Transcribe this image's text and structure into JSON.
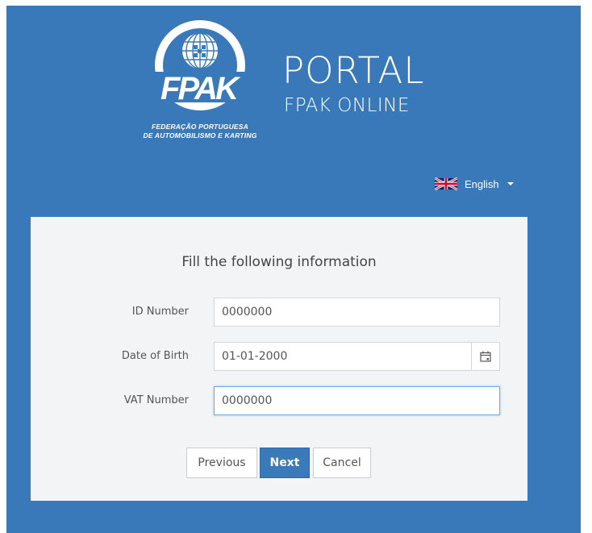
{
  "logo": {
    "initials": "FPAK",
    "subtitle_line1": "FEDERAÇÃO PORTUGUESA",
    "subtitle_line2": "DE AUTOMOBILISMO E KARTING"
  },
  "brand": {
    "title": "PORTAL",
    "subtitle": "FPAK ONLINE"
  },
  "language": {
    "selected": "English",
    "flag_icon": "uk-flag-icon"
  },
  "form": {
    "title": "Fill the following information",
    "fields": {
      "id_number": {
        "label": "ID Number",
        "value": "0000000"
      },
      "date_of_birth": {
        "label": "Date of Birth",
        "value": "01-01-2000"
      },
      "vat_number": {
        "label": "VAT Number",
        "value": "0000000"
      }
    },
    "buttons": {
      "previous": "Previous",
      "next": "Next",
      "cancel": "Cancel"
    }
  },
  "colors": {
    "background": "#3979b9",
    "card": "#f3f4f5",
    "primary_button": "#3a7ab9"
  }
}
